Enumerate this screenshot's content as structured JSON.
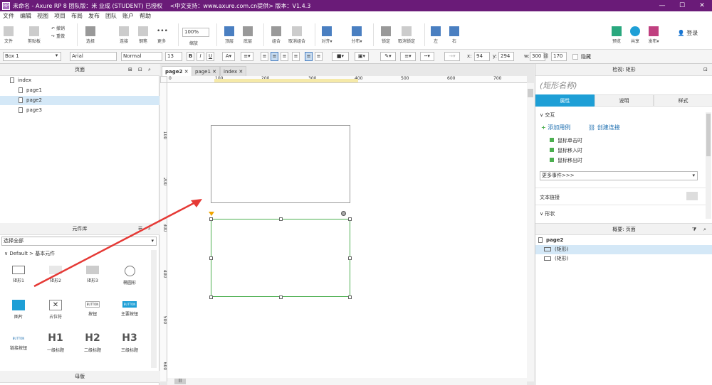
{
  "title": "未命名 - Axure RP 8 团队版：米 业成 (STUDENT) 已授权　 <中文支持：www.axure.com.cn提供> 版本：V1.4.3",
  "window": {
    "min": "—",
    "max": "☐",
    "close": "✕"
  },
  "menu": [
    "文件",
    "编辑",
    "视图",
    "项目",
    "布局",
    "发布",
    "团队",
    "账户",
    "帮助"
  ],
  "toolbar": {
    "file": "文件",
    "clipboard": "剪贴板",
    "undo": "撤销",
    "redo": "重做",
    "select": "选择",
    "connect": "连接",
    "pen": "钢笔",
    "more": "更多",
    "zoom": "100%",
    "zoom_label": "缩放",
    "top": "顶层",
    "bottom": "底层",
    "group": "组合",
    "ungroup": "取消组合",
    "align": "对齐",
    "distribute": "分布",
    "lock": "锁定",
    "unlock": "取消锁定",
    "left": "左",
    "right": "右",
    "preview": "预览",
    "share": "共享",
    "publish": "发布",
    "login": "登录"
  },
  "format": {
    "widget_name": "Box 1",
    "font": "Arial",
    "style": "Normal",
    "size": "13",
    "x_label": "x:",
    "x": "94",
    "y_label": "y:",
    "y": "294",
    "w_label": "w:",
    "w": "300",
    "h": "170",
    "hidden": "隐藏"
  },
  "pages_panel": {
    "title": "页面",
    "items": [
      "index",
      "page1",
      "page2",
      "page3"
    ]
  },
  "library": {
    "title": "元件库",
    "select": "选择全部",
    "group": "Default > 基本元件",
    "widgets": [
      "矩形1",
      "矩形2",
      "矩形3",
      "椭圆形",
      "图片",
      "占位符",
      "按钮",
      "主要按钮",
      "链接按钮",
      "一级标题",
      "二级标题",
      "三级标题"
    ],
    "h1": "H1",
    "h2": "H2",
    "h3": "H3",
    "btn": "BUTTON"
  },
  "master": {
    "title": "母版"
  },
  "tabs": [
    "page2",
    "page1",
    "index"
  ],
  "ruler_h": [
    "0",
    "100",
    "200",
    "300",
    "400",
    "500",
    "600",
    "700"
  ],
  "ruler_v": [
    "100",
    "200",
    "300",
    "400",
    "500",
    "600"
  ],
  "inspector": {
    "title": "检视: 矩形",
    "name_placeholder": "(矩形名称)",
    "tabs": [
      "属性",
      "说明",
      "样式"
    ],
    "interaction": "交互",
    "add_case": "添加用例",
    "create_link": "创建连接",
    "events": [
      "鼠标单击时",
      "鼠标移入时",
      "鼠标移出时"
    ],
    "more_events": "更多事件>>>",
    "text_link": "文本链接",
    "shape": "形状"
  },
  "outline": {
    "title": "概要: 页面",
    "page": "page2",
    "items": [
      "(矩形)",
      "(矩形)"
    ]
  },
  "colors": {
    "accent": "#1e9fd6",
    "selection": "#4caf50",
    "arrow": "#e53935",
    "title_bg": "#6a1b78"
  }
}
